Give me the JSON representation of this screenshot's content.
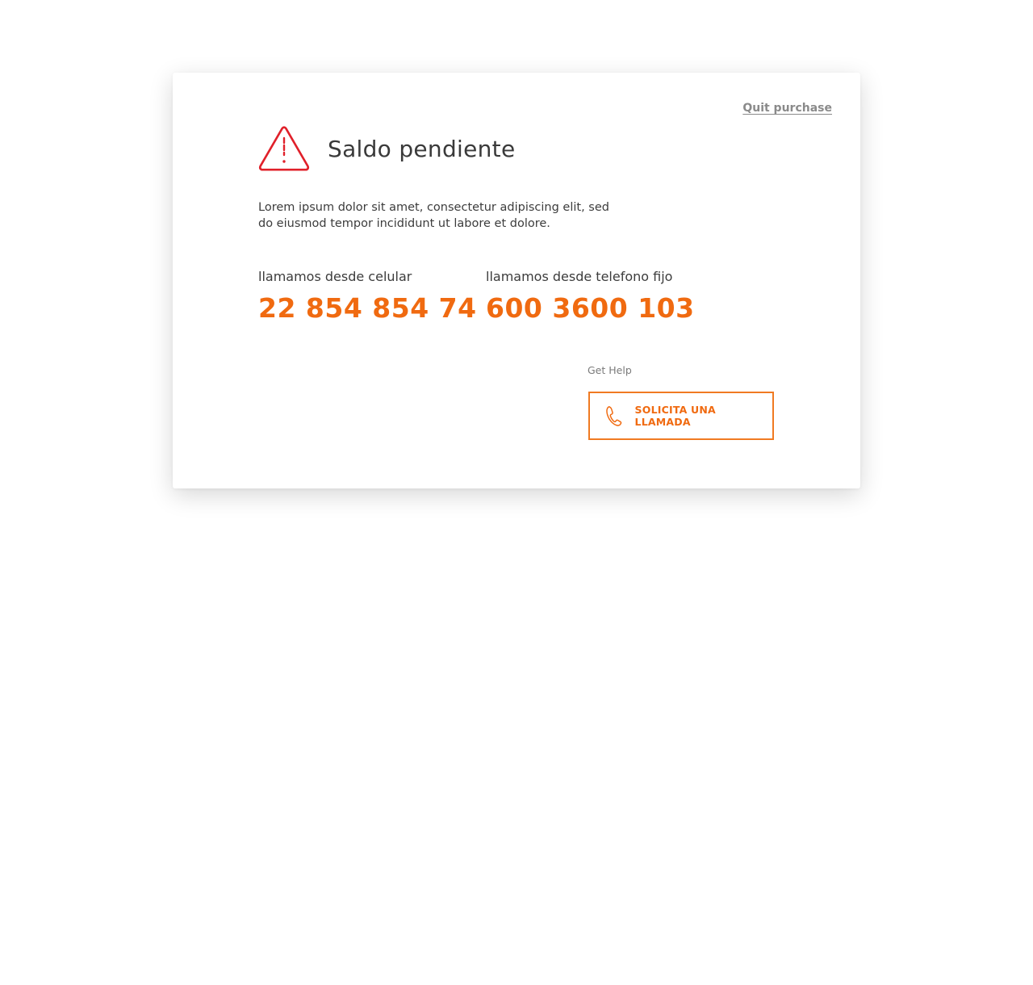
{
  "dialog": {
    "quit_label": "Quit purchase",
    "title": "Saldo pendiente",
    "description": "Lorem ipsum dolor sit amet, consectetur adipiscing elit, sed do eiusmod tempor incididunt ut labore et dolore.",
    "warning_icon": "warning-triangle-icon",
    "colors": {
      "accent": "#f06a10",
      "warning": "#e0202a",
      "text": "#3c3c3c"
    }
  },
  "phones": {
    "mobile": {
      "label": "llamamos desde celular",
      "number": "22 854 854 74"
    },
    "landline": {
      "label": "llamamos desde telefono fijo",
      "number": "600 3600 103"
    }
  },
  "help": {
    "label": "Get Help",
    "button_label": "SOLICITA UNA LLAMADA",
    "button_icon": "phone-icon"
  }
}
